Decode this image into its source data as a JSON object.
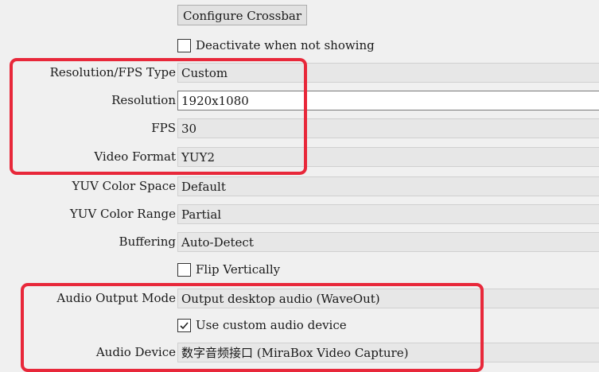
{
  "crossbar_button": "Configure Crossbar",
  "deactivate_checkbox": {
    "label": "Deactivate when not showing",
    "checked": false
  },
  "rows": {
    "resolution_type": {
      "label": "Resolution/FPS Type",
      "value": "Custom"
    },
    "resolution": {
      "label": "Resolution",
      "value": "1920x1080"
    },
    "fps": {
      "label": "FPS",
      "value": "30"
    },
    "video_format": {
      "label": "Video Format",
      "value": "YUY2"
    },
    "color_space": {
      "label": "YUV Color Space",
      "value": "Default"
    },
    "color_range": {
      "label": "YUV Color Range",
      "value": "Partial"
    },
    "buffering": {
      "label": "Buffering",
      "value": "Auto-Detect"
    },
    "audio_output_mode": {
      "label": "Audio Output Mode",
      "value": "Output desktop audio (WaveOut)"
    },
    "audio_device": {
      "label": "Audio Device",
      "value": "数字音频接口 (MiraBox Video Capture)"
    }
  },
  "flip_checkbox": {
    "label": "Flip Vertically",
    "checked": false
  },
  "custom_audio_checkbox": {
    "label": "Use custom audio device",
    "checked": true
  },
  "colors": {
    "highlight": "#e8283a",
    "background": "#f0f0f0"
  }
}
